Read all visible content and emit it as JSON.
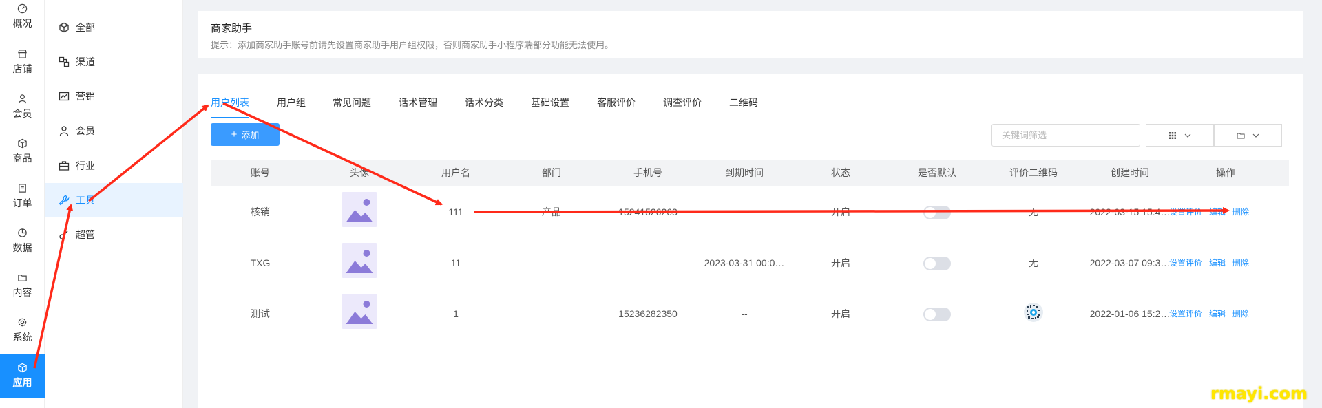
{
  "nav": [
    {
      "label": "概况",
      "icon": "dashboard-icon"
    },
    {
      "label": "店铺",
      "icon": "store-icon"
    },
    {
      "label": "会员",
      "icon": "user-icon"
    },
    {
      "label": "商品",
      "icon": "box-icon"
    },
    {
      "label": "订单",
      "icon": "order-icon"
    },
    {
      "label": "数据",
      "icon": "chart-pie-icon"
    },
    {
      "label": "内容",
      "icon": "folder-icon"
    },
    {
      "label": "系统",
      "icon": "gear-icon"
    },
    {
      "label": "应用",
      "icon": "cube-icon",
      "active": true
    }
  ],
  "submenu": [
    {
      "label": "全部",
      "icon": "cube-icon"
    },
    {
      "label": "渠道",
      "icon": "channel-icon"
    },
    {
      "label": "营销",
      "icon": "marketing-icon"
    },
    {
      "label": "会员",
      "icon": "user-icon"
    },
    {
      "label": "行业",
      "icon": "briefcase-icon"
    },
    {
      "label": "工具",
      "icon": "wrench-icon",
      "active": true
    },
    {
      "label": "超管",
      "icon": "admin-icon"
    }
  ],
  "header": {
    "title": "商家助手",
    "tip": "提示：添加商家助手账号前请先设置商家助手用户组权限，否则商家助手小程序端部分功能无法使用。"
  },
  "tabs": [
    "用户列表",
    "用户组",
    "常见问题",
    "话术管理",
    "话术分类",
    "基础设置",
    "客服评价",
    "调查评价",
    "二维码"
  ],
  "toolbar": {
    "add_label": "添加",
    "search_placeholder": "关键词筛选"
  },
  "table": {
    "columns": [
      "账号",
      "头像",
      "用户名",
      "部门",
      "手机号",
      "到期时间",
      "状态",
      "是否默认",
      "评价二维码",
      "创建时间",
      "操作"
    ],
    "rows": [
      {
        "account": "核销",
        "username": "111",
        "dept": "产品",
        "phone": "15241526263",
        "expire": "--",
        "status": "开启",
        "qr": "无",
        "created": "2022-03-15 15:4…",
        "ops": [
          "设置评价",
          "编辑",
          "删除"
        ]
      },
      {
        "account": "TXG",
        "username": "11",
        "dept": "",
        "phone": "",
        "expire": "2023-03-31 00:0…",
        "status": "开启",
        "qr": "无",
        "created": "2022-03-07 09:3…",
        "ops": [
          "设置评价",
          "编辑",
          "删除"
        ]
      },
      {
        "account": "测试",
        "username": "1",
        "dept": "",
        "phone": "15236282350",
        "expire": "--",
        "status": "开启",
        "qr": "",
        "created": "2022-01-06 15:2…",
        "ops": [
          "设置评价",
          "编辑",
          "删除"
        ]
      }
    ]
  },
  "colors": {
    "accent": "#1890ff",
    "arrow": "#ff2a1a",
    "watermark": "#ffe600"
  },
  "watermark": "rmayi.com"
}
